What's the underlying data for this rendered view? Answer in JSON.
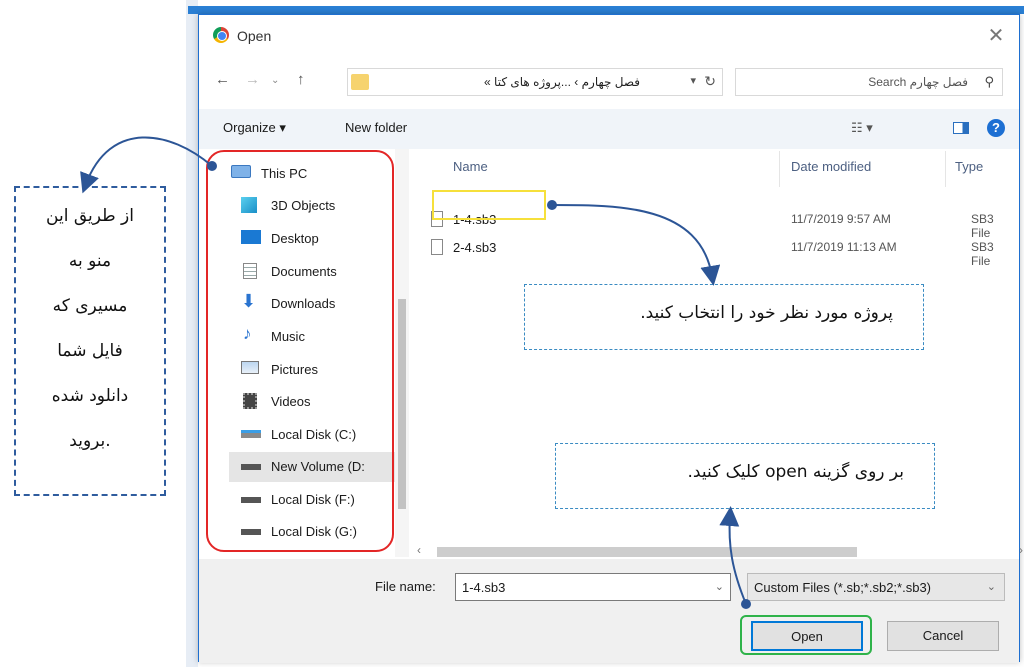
{
  "window": {
    "title": "Open",
    "close_icon": "close-icon"
  },
  "nav": {
    "breadcrumb": "فصل چهارم  ›  ...پروژه های کتا  »",
    "search_placeholder": "Search فصل چهارم"
  },
  "toolbar": {
    "organize": "Organize ▾",
    "new_folder": "New folder",
    "help": "?"
  },
  "sidebar": {
    "items": [
      {
        "label": "This PC",
        "icon": "pc-icon"
      },
      {
        "label": "3D Objects",
        "icon": "cube-icon"
      },
      {
        "label": "Desktop",
        "icon": "desktop-icon"
      },
      {
        "label": "Documents",
        "icon": "document-icon"
      },
      {
        "label": "Downloads",
        "icon": "download-icon"
      },
      {
        "label": "Music",
        "icon": "music-icon"
      },
      {
        "label": "Pictures",
        "icon": "pictures-icon"
      },
      {
        "label": "Videos",
        "icon": "video-icon"
      },
      {
        "label": "Local Disk (C:)",
        "icon": "drive-icon"
      },
      {
        "label": "New Volume (D:",
        "icon": "drive-icon"
      },
      {
        "label": "Local Disk (F:)",
        "icon": "drive-icon"
      },
      {
        "label": "Local Disk (G:)",
        "icon": "drive-icon"
      }
    ]
  },
  "files": {
    "columns": [
      "Name",
      "Date modified",
      "Type"
    ],
    "rows": [
      {
        "name": "1-4.sb3",
        "date": "11/7/2019 9:57 AM",
        "type": "SB3 File"
      },
      {
        "name": "2-4.sb3",
        "date": "11/7/2019 11:13 AM",
        "type": "SB3 File"
      }
    ]
  },
  "footer": {
    "file_name_label": "File name:",
    "file_name_value": "1-4.sb3",
    "filter": "Custom Files (*.sb;*.sb2;*.sb3)",
    "open": "Open",
    "cancel": "Cancel"
  },
  "annotations": {
    "left_note": [
      "از طریق این",
      "منو به",
      "مسیری که",
      "فایل شما",
      "دانلود شده",
      "بروید."
    ],
    "mid_note": "پروژه مورد نظر خود را انتخاب کنید.",
    "bottom_note": "بر روی گزینه open کلیک کنید."
  },
  "colors": {
    "accent": "#1e6fd0",
    "red_highlight": "#e32626",
    "yellow_highlight": "#f6e03b",
    "green_highlight": "#2fb34a",
    "arrow": "#2c5596"
  }
}
